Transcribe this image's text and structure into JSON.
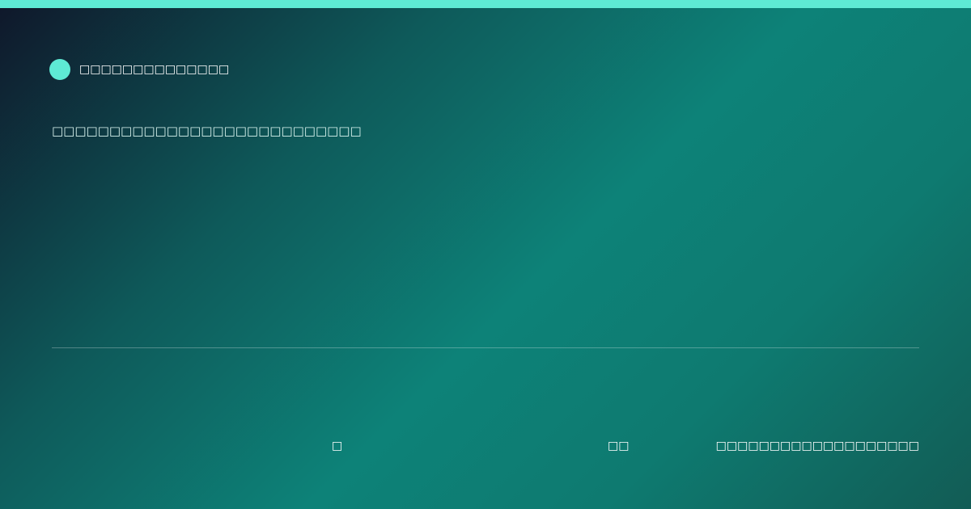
{
  "colors": {
    "accent": "#5eead4"
  },
  "brand": {
    "icon": "circle-icon",
    "name": "□□□□□□□□□□□□□□"
  },
  "headline": "□□□□□□□□□□□□□□□□□□□□□□□□□□□",
  "footer": {
    "item_1": "□",
    "item_2": "□□",
    "item_3": "□□□□□□□□□□□□□□□□□□□"
  }
}
